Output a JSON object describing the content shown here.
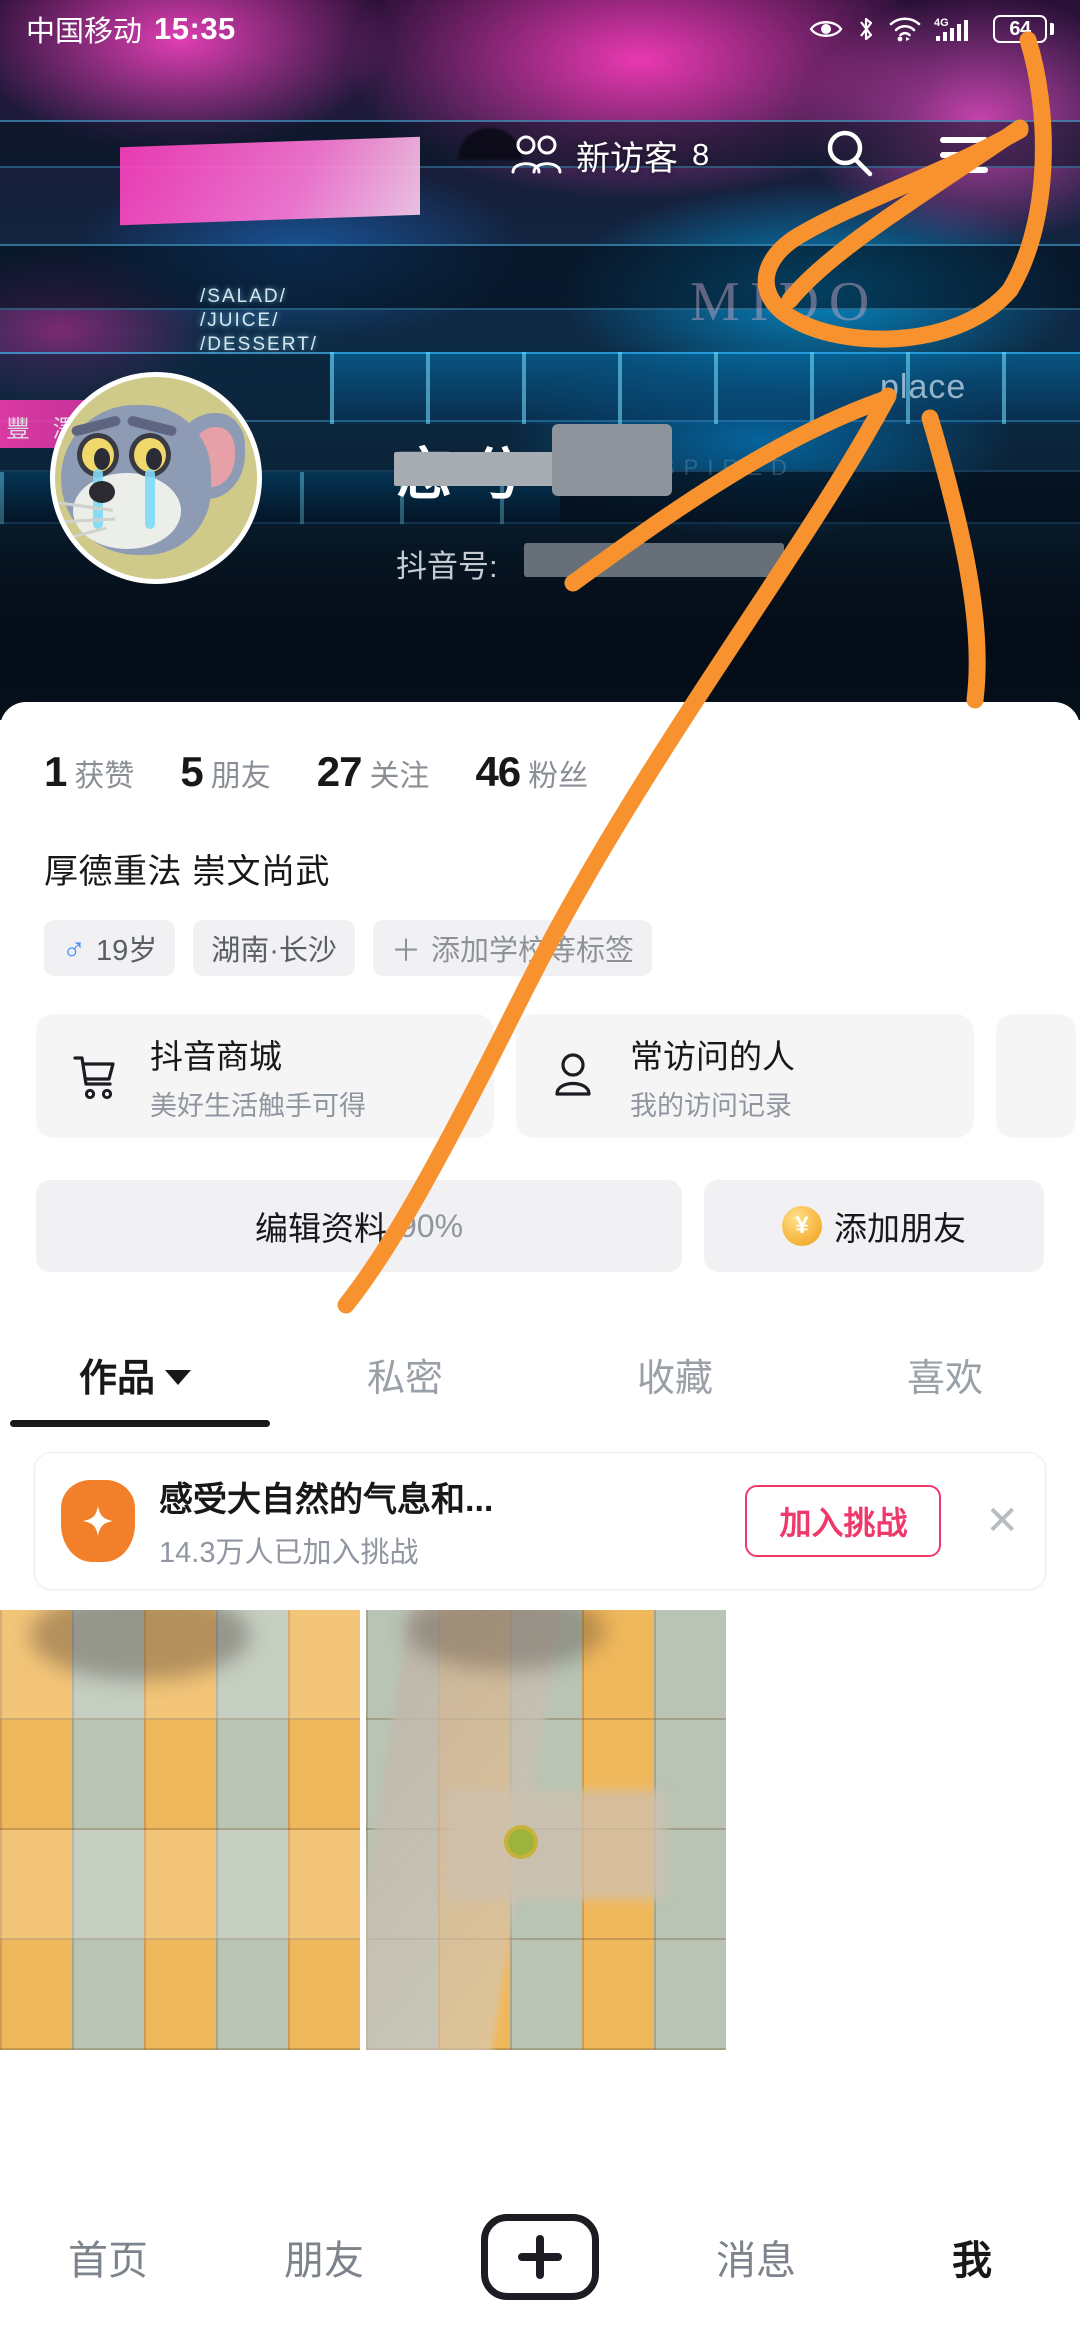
{
  "status_bar": {
    "carrier": "中国移动",
    "time": "15:35",
    "battery_level": "64",
    "icons": [
      "eye-icon",
      "bluetooth-off-icon",
      "wifi-icon",
      "signal-4g-icon",
      "battery-icon"
    ],
    "network": "4G"
  },
  "cover": {
    "sign_line1": "/SALAD/",
    "sign_line2": "/JUICE/",
    "sign_line3": "/DESSERT/",
    "neon_text": "MIDO",
    "place_text": "place",
    "inspired_text": "INSPIRED",
    "cn_sign": "豐 澤 美"
  },
  "header": {
    "visitors_label": "新访客",
    "visitors_count": "8",
    "search_icon": "search-icon",
    "menu_icon": "hamburger-menu-icon"
  },
  "profile": {
    "username": "恋 兮",
    "douyin_id_label": "抖音号:",
    "bio": "厚德重法 崇文尚武",
    "stats": [
      {
        "num": "1",
        "label": "获赞"
      },
      {
        "num": "5",
        "label": "朋友"
      },
      {
        "num": "27",
        "label": "关注"
      },
      {
        "num": "46",
        "label": "粉丝"
      }
    ],
    "tags": [
      {
        "icon": "male-icon",
        "text": "19岁"
      },
      {
        "icon": "",
        "text": "湖南·长沙"
      },
      {
        "icon": "plus-icon",
        "text": "添加学校等标签"
      }
    ]
  },
  "services": [
    {
      "icon": "shopping-cart-icon",
      "title": "抖音商城",
      "subtitle": "美好生活触手可得"
    },
    {
      "icon": "person-icon",
      "title": "常访问的人",
      "subtitle": "我的访问记录"
    }
  ],
  "actions": {
    "edit_profile_label": "编辑资料",
    "edit_profile_percent": "90%",
    "add_friend_label": "添加朋友",
    "add_friend_icon": "yen-coin-icon"
  },
  "tabs": [
    {
      "label": "作品",
      "active": true,
      "caret": "chevron-down-icon"
    },
    {
      "label": "私密",
      "active": false
    },
    {
      "label": "收藏",
      "active": false
    },
    {
      "label": "喜欢",
      "active": false
    }
  ],
  "challenge": {
    "icon": "sparkle-icon",
    "title": "感受大自然的气息和...",
    "subtitle": "14.3万人已加入挑战",
    "button_label": "加入挑战",
    "close_label": "✕"
  },
  "bottom_nav": [
    {
      "label": "首页",
      "active": false
    },
    {
      "label": "朋友",
      "active": false
    },
    {
      "label": "",
      "active": false,
      "icon": "plus-create-icon"
    },
    {
      "label": "消息",
      "active": false
    },
    {
      "label": "我",
      "active": true
    }
  ],
  "annotation": {
    "color": "#F7922E",
    "shape": "circle-around-menu-with-arrow-pointing-up"
  },
  "colors": {
    "accent_orange": "#F7922E",
    "challenge_red": "#F0396B",
    "male_blue": "#3C8EF0",
    "text_primary": "#16181A",
    "text_muted": "#9096A0",
    "chip_bg": "#F1F1F3"
  }
}
